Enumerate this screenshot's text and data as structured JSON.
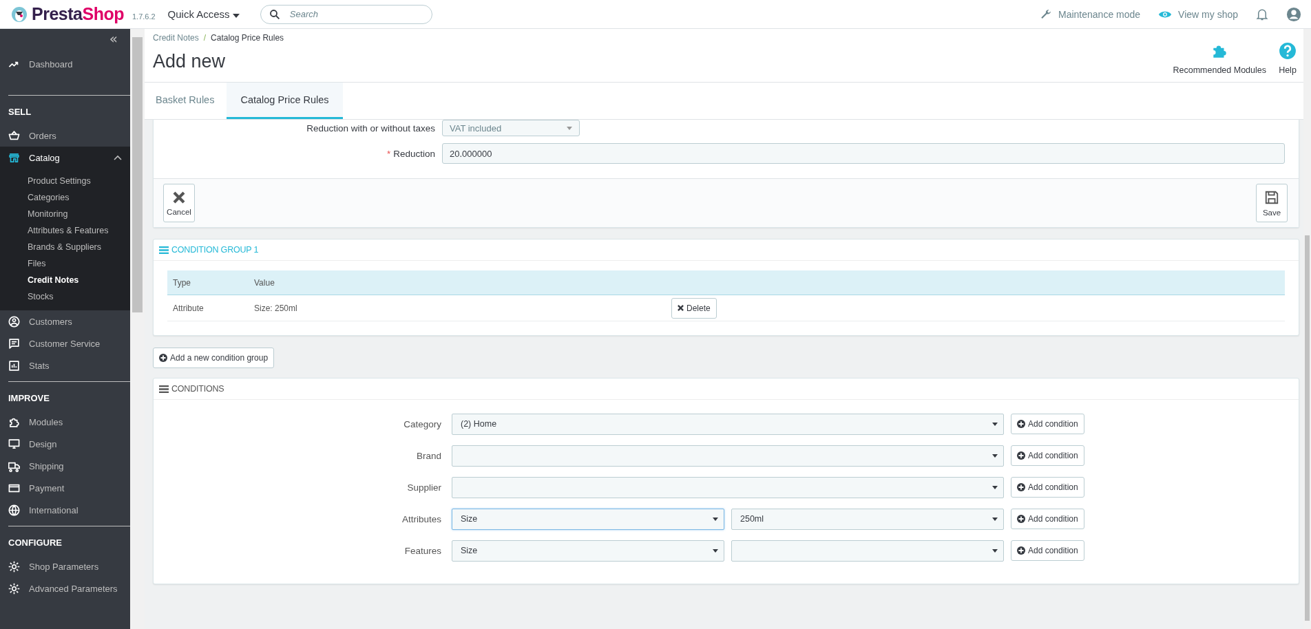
{
  "header": {
    "logo_parts": [
      "Presta",
      "Shop"
    ],
    "version": "1.7.6.2",
    "quick_access": "Quick Access",
    "search": {
      "placeholder": "Search"
    },
    "maintenance": "Maintenance mode",
    "view_shop": "View my shop"
  },
  "sidebar": {
    "collapse": "«",
    "sections": [
      {
        "items": [
          {
            "label": "Dashboard",
            "selected": false,
            "expanded": false
          }
        ]
      },
      {
        "heading": "SELL",
        "items": [
          {
            "label": "Orders",
            "selected": false,
            "expanded": false
          },
          {
            "label": "Catalog",
            "selected": true,
            "expanded": true,
            "children": [
              {
                "label": "Product Settings",
                "selected": false
              },
              {
                "label": "Categories",
                "selected": false
              },
              {
                "label": "Monitoring",
                "selected": false
              },
              {
                "label": "Attributes & Features",
                "selected": false
              },
              {
                "label": "Brands & Suppliers",
                "selected": false
              },
              {
                "label": "Files",
                "selected": false
              },
              {
                "label": "Credit Notes",
                "selected": true
              },
              {
                "label": "Stocks",
                "selected": false
              }
            ]
          },
          {
            "label": "Customers",
            "selected": false,
            "expanded": false
          },
          {
            "label": "Customer Service",
            "selected": false,
            "expanded": false
          },
          {
            "label": "Stats",
            "selected": false,
            "expanded": false
          }
        ]
      },
      {
        "heading": "IMPROVE",
        "items": [
          {
            "label": "Modules",
            "selected": false,
            "expanded": false
          },
          {
            "label": "Design",
            "selected": false,
            "expanded": false
          },
          {
            "label": "Shipping",
            "selected": false,
            "expanded": false
          },
          {
            "label": "Payment",
            "selected": false,
            "expanded": false
          },
          {
            "label": "International",
            "selected": false,
            "expanded": false
          }
        ]
      },
      {
        "heading": "CONFIGURE",
        "items": [
          {
            "label": "Shop Parameters",
            "selected": false,
            "expanded": false
          },
          {
            "label": "Advanced Parameters",
            "selected": false,
            "expanded": false
          }
        ]
      }
    ]
  },
  "breadcrumb": [
    "Credit Notes",
    "Catalog Price Rules"
  ],
  "breadcrumb_separator": "/",
  "title": "Add new",
  "toolbar": [
    {
      "label": "Recommended Modules",
      "kind": "modules"
    },
    {
      "label": "Help",
      "kind": "help"
    }
  ],
  "tabs": [
    {
      "label": "Basket Rules",
      "selected": false
    },
    {
      "label": "Catalog Price Rules",
      "selected": true
    }
  ],
  "form": {
    "fields": [
      {
        "label": "Reduction with or without taxes",
        "value": "VAT included",
        "required": false,
        "kind": "select"
      },
      {
        "label": "Reduction",
        "value": "20.000000",
        "required": true,
        "kind": "text"
      }
    ],
    "required_mark": "*",
    "cancel": "Cancel",
    "save": "Save"
  },
  "condition_group": {
    "title": "CONDITION GROUP 1",
    "columns": [
      "Type",
      "Value"
    ],
    "rows": [
      {
        "type": "Attribute",
        "value": "Size: 250ml",
        "action": "Delete"
      }
    ]
  },
  "add_group": "Add a new condition group",
  "conditions": {
    "title": "CONDITIONS",
    "rows": [
      {
        "label": "Category",
        "selects": [
          {
            "value": "(2) Home",
            "focused": false
          }
        ],
        "action": "Add condition"
      },
      {
        "label": "Brand",
        "selects": [
          {
            "focused": false
          }
        ],
        "action": "Add condition"
      },
      {
        "label": "Supplier",
        "selects": [
          {
            "focused": false
          }
        ],
        "action": "Add condition"
      },
      {
        "label": "Attributes",
        "selects": [
          {
            "value": "Size",
            "focused": true
          },
          {
            "value": "250ml",
            "focused": false
          }
        ],
        "action": "Add condition"
      },
      {
        "label": "Features",
        "selects": [
          {
            "value": "Size",
            "focused": false
          },
          {
            "focused": false
          }
        ],
        "action": "Add condition"
      }
    ]
  }
}
